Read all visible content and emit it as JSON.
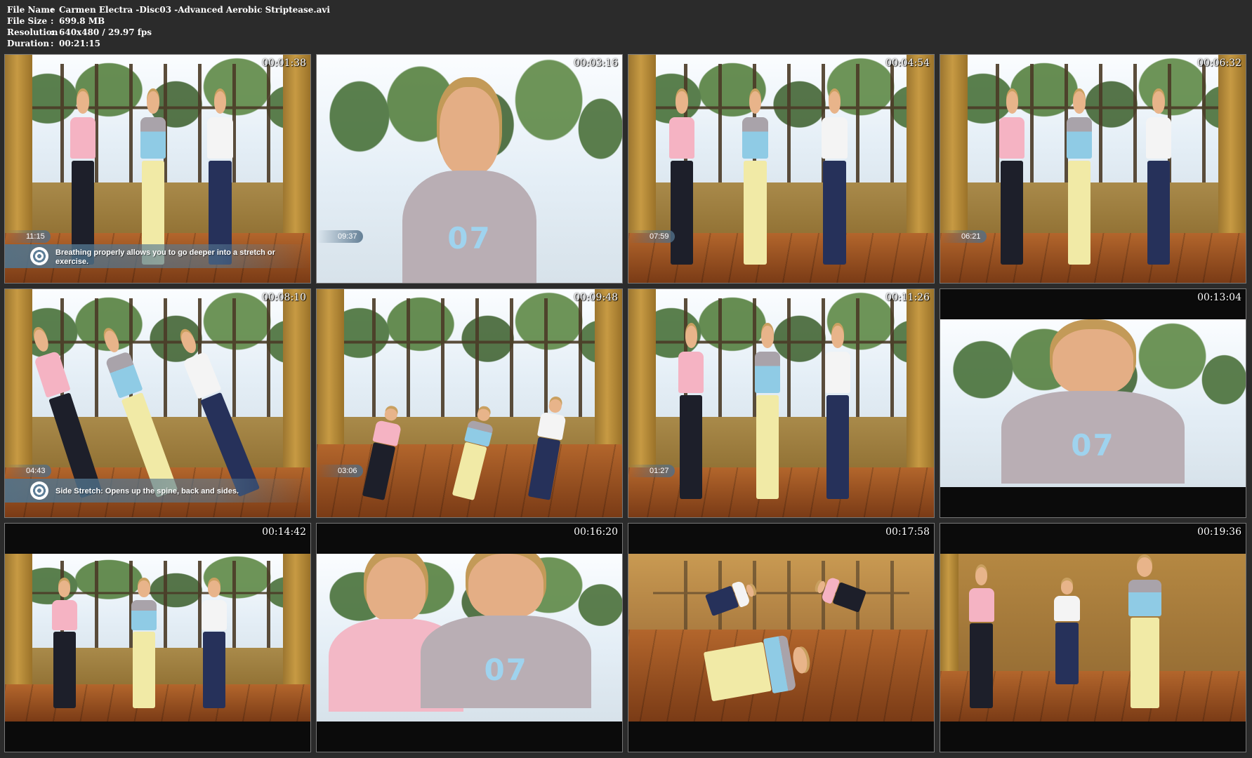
{
  "file_info": [
    {
      "key": "File Name",
      "value": "Carmen Electra -Disc03 -Advanced Aerobic Striptease.avi"
    },
    {
      "key": "File Size",
      "value": "699.8 MB"
    },
    {
      "key": "Resolution",
      "value": "640x480 / 29.97 fps"
    },
    {
      "key": "Duration",
      "value": "00:21:15"
    }
  ],
  "separator": ":",
  "thumbnails": [
    {
      "timestamp": "00:01:38",
      "overlay_time": "11:15",
      "tip": "Breathing properly allows you to go deeper into a stretch or exercise."
    },
    {
      "timestamp": "00:03:16",
      "overlay_time": "09:37"
    },
    {
      "timestamp": "00:04:54",
      "overlay_time": "07:59"
    },
    {
      "timestamp": "00:06:32",
      "overlay_time": "06:21"
    },
    {
      "timestamp": "00:08:10",
      "overlay_time": "04:43",
      "tip": "Side Stretch: Opens up the spine, back and sides."
    },
    {
      "timestamp": "00:09:48",
      "overlay_time": "03:06"
    },
    {
      "timestamp": "00:11:26",
      "overlay_time": "01:27"
    },
    {
      "timestamp": "00:13:04"
    },
    {
      "timestamp": "00:14:42"
    },
    {
      "timestamp": "00:16:20"
    },
    {
      "timestamp": "00:17:58"
    },
    {
      "timestamp": "00:19:36"
    }
  ],
  "shirt_number": "07"
}
